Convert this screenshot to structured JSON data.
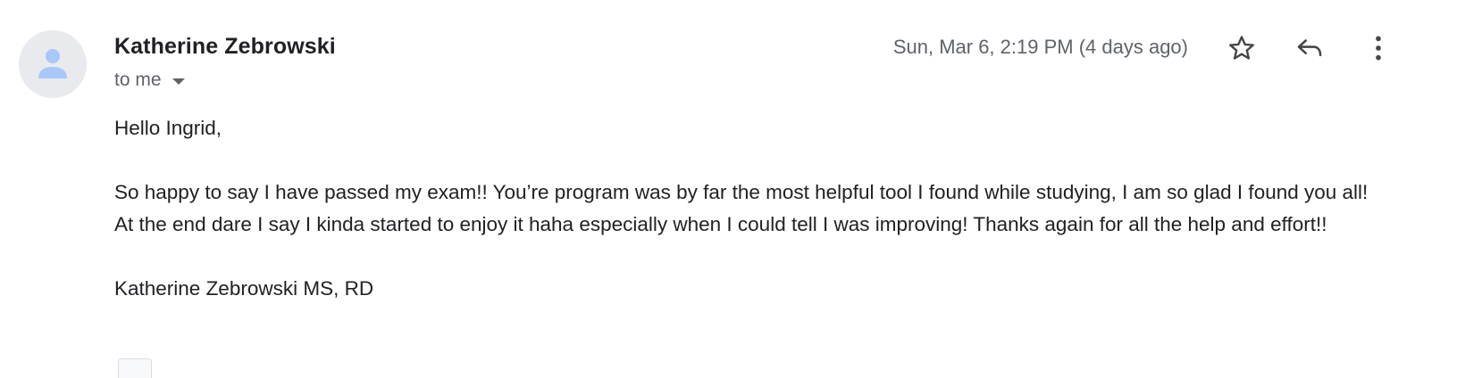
{
  "sender": {
    "name": "Katherine Zebrowski",
    "avatar_icon": "person-icon"
  },
  "recipient": {
    "label": "to me"
  },
  "meta": {
    "date": "Sun, Mar 6, 2:19 PM (4 days ago)"
  },
  "actions": {
    "star_icon": "star-outline-icon",
    "reply_icon": "reply-icon",
    "more_icon": "more-vertical-icon"
  },
  "message": {
    "greeting": "Hello Ingrid,",
    "paragraph": "So happy to say I have passed my exam!! You’re program was by far the most helpful tool I found while studying, I am so glad I found you all! At the end dare I say I kinda started to enjoy it haha especially when I could tell I was improving! Thanks again for all the help and effort!!",
    "signature": "Katherine Zebrowski MS, RD"
  },
  "colors": {
    "avatar_bg": "#e8eaed",
    "avatar_icon": "#a8c7fa",
    "secondary_text": "#5f6368",
    "primary_text": "#202124"
  }
}
